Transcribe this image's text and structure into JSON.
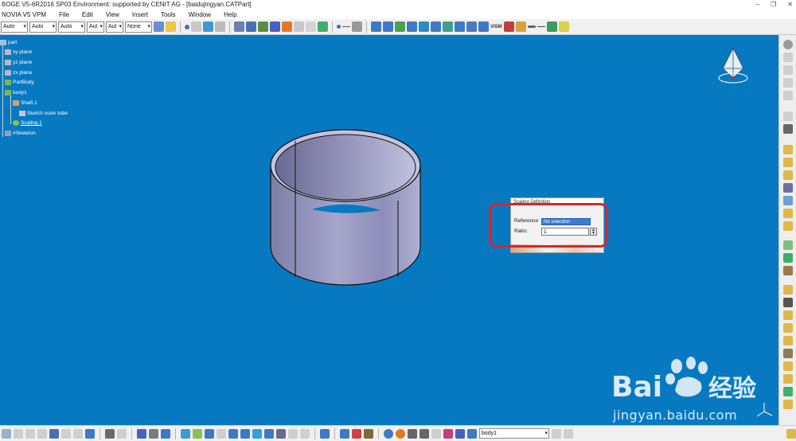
{
  "window": {
    "title": "BOGE V5-6R2016 SP03 Environment: supported by CENIT AG - [baidujingyan.CATPart]",
    "controls": [
      "–",
      "❐",
      "✕"
    ]
  },
  "menu": {
    "app": "NOVIA V5 VPM",
    "items": [
      "File",
      "Edit",
      "View",
      "Insert",
      "Tools",
      "Window",
      "Help"
    ]
  },
  "toolbar": {
    "combos": [
      "Auto",
      "Auto",
      "Auto",
      "Aut",
      "Aut",
      "None"
    ],
    "label_vis": "VISM"
  },
  "tree": {
    "root": "part",
    "planes": [
      "xy plane",
      "yz plane",
      "zx plane"
    ],
    "partbody": "PartBody",
    "body": "body1",
    "shaft": "Shaft.1",
    "sketch": "Sketch outer tube",
    "scaling": "Scaling.1",
    "skeleton": "#Skeleton"
  },
  "dialog": {
    "title": "Scaling Definition",
    "reference_label": "Reference:",
    "reference_value": "No selection",
    "ratio_label": "Ratio:",
    "ratio_value": "1"
  },
  "bottombar": {
    "body_combo": "body1"
  },
  "watermark": {
    "brand": "Bai",
    "brand_cn": "经验",
    "url": "jingyan.baidu.com"
  },
  "colors": {
    "viewport": "#0779c1",
    "highlight": "#e0222b",
    "tube": "#9a9ac8"
  }
}
